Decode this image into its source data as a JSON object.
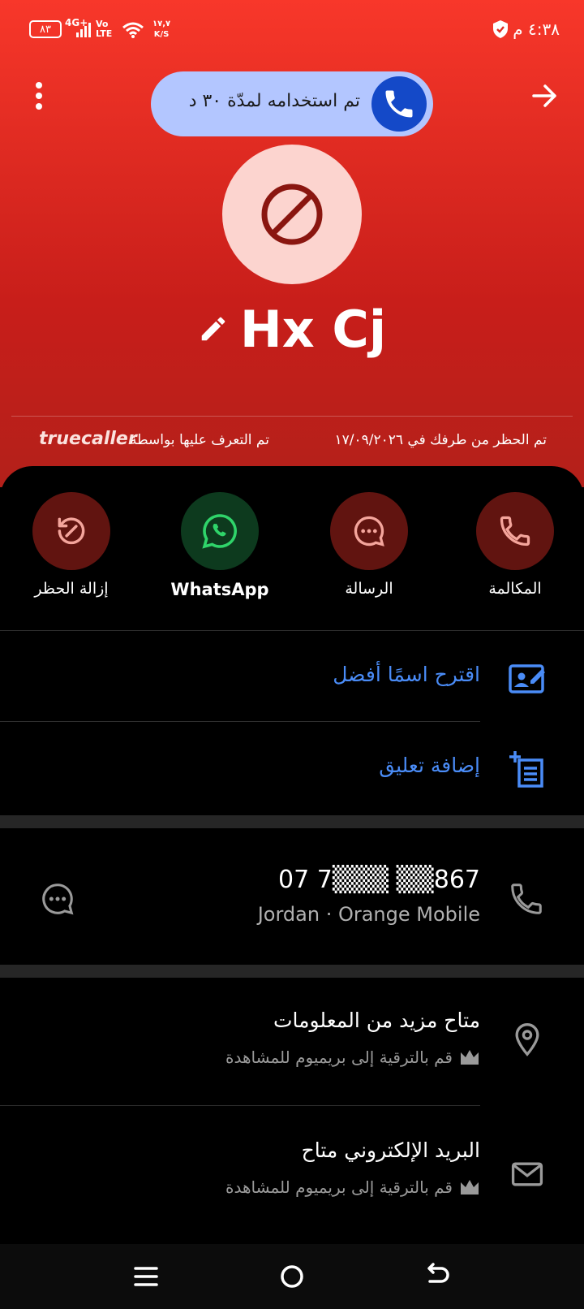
{
  "status_bar": {
    "time": "٤:٣٨ م",
    "battery": "٨٣",
    "network": "4G+",
    "volte": "Vo\nLTE",
    "speed": "١٧,٧\nK/S"
  },
  "usage_pill": {
    "text": "تم استخدامه لمدّة ٣٠ د"
  },
  "contact": {
    "name": "Hx Cj"
  },
  "block_info": {
    "blocked_on": "تم الحظر من طرفك في ١٧/٠٩/٢٠٢٦",
    "identified_by": "تم التعرف عليها بواسطة",
    "brand": "truecaller"
  },
  "actions": [
    {
      "label": "المكالمة",
      "icon": "phone-icon"
    },
    {
      "label": "الرسالة",
      "icon": "message-icon"
    },
    {
      "label": "WhatsApp",
      "icon": "whatsapp-icon"
    },
    {
      "label": "إزالة الحظر",
      "icon": "unblock-icon"
    }
  ],
  "suggest_name": {
    "label": "اقترح اسمًا أفضل",
    "icon": "edit-contact-icon"
  },
  "add_comment": {
    "label": "إضافة تعليق",
    "icon": "add-note-icon"
  },
  "phone": {
    "number": "07 7▒▒▒ ▒▒867",
    "carrier": "Jordan · Orange Mobile"
  },
  "more_info": {
    "title": "متاح مزيد من المعلومات",
    "subtitle": "قم بالترقية إلى بريميوم للمشاهدة"
  },
  "email_info": {
    "title": "البريد الإلكتروني متاح",
    "subtitle": "قم بالترقية إلى بريميوم للمشاهدة"
  },
  "colors": {
    "header_red": "#e02b22",
    "accent_blue": "#4a8cf7",
    "pill_bg": "#b3c6ff"
  }
}
